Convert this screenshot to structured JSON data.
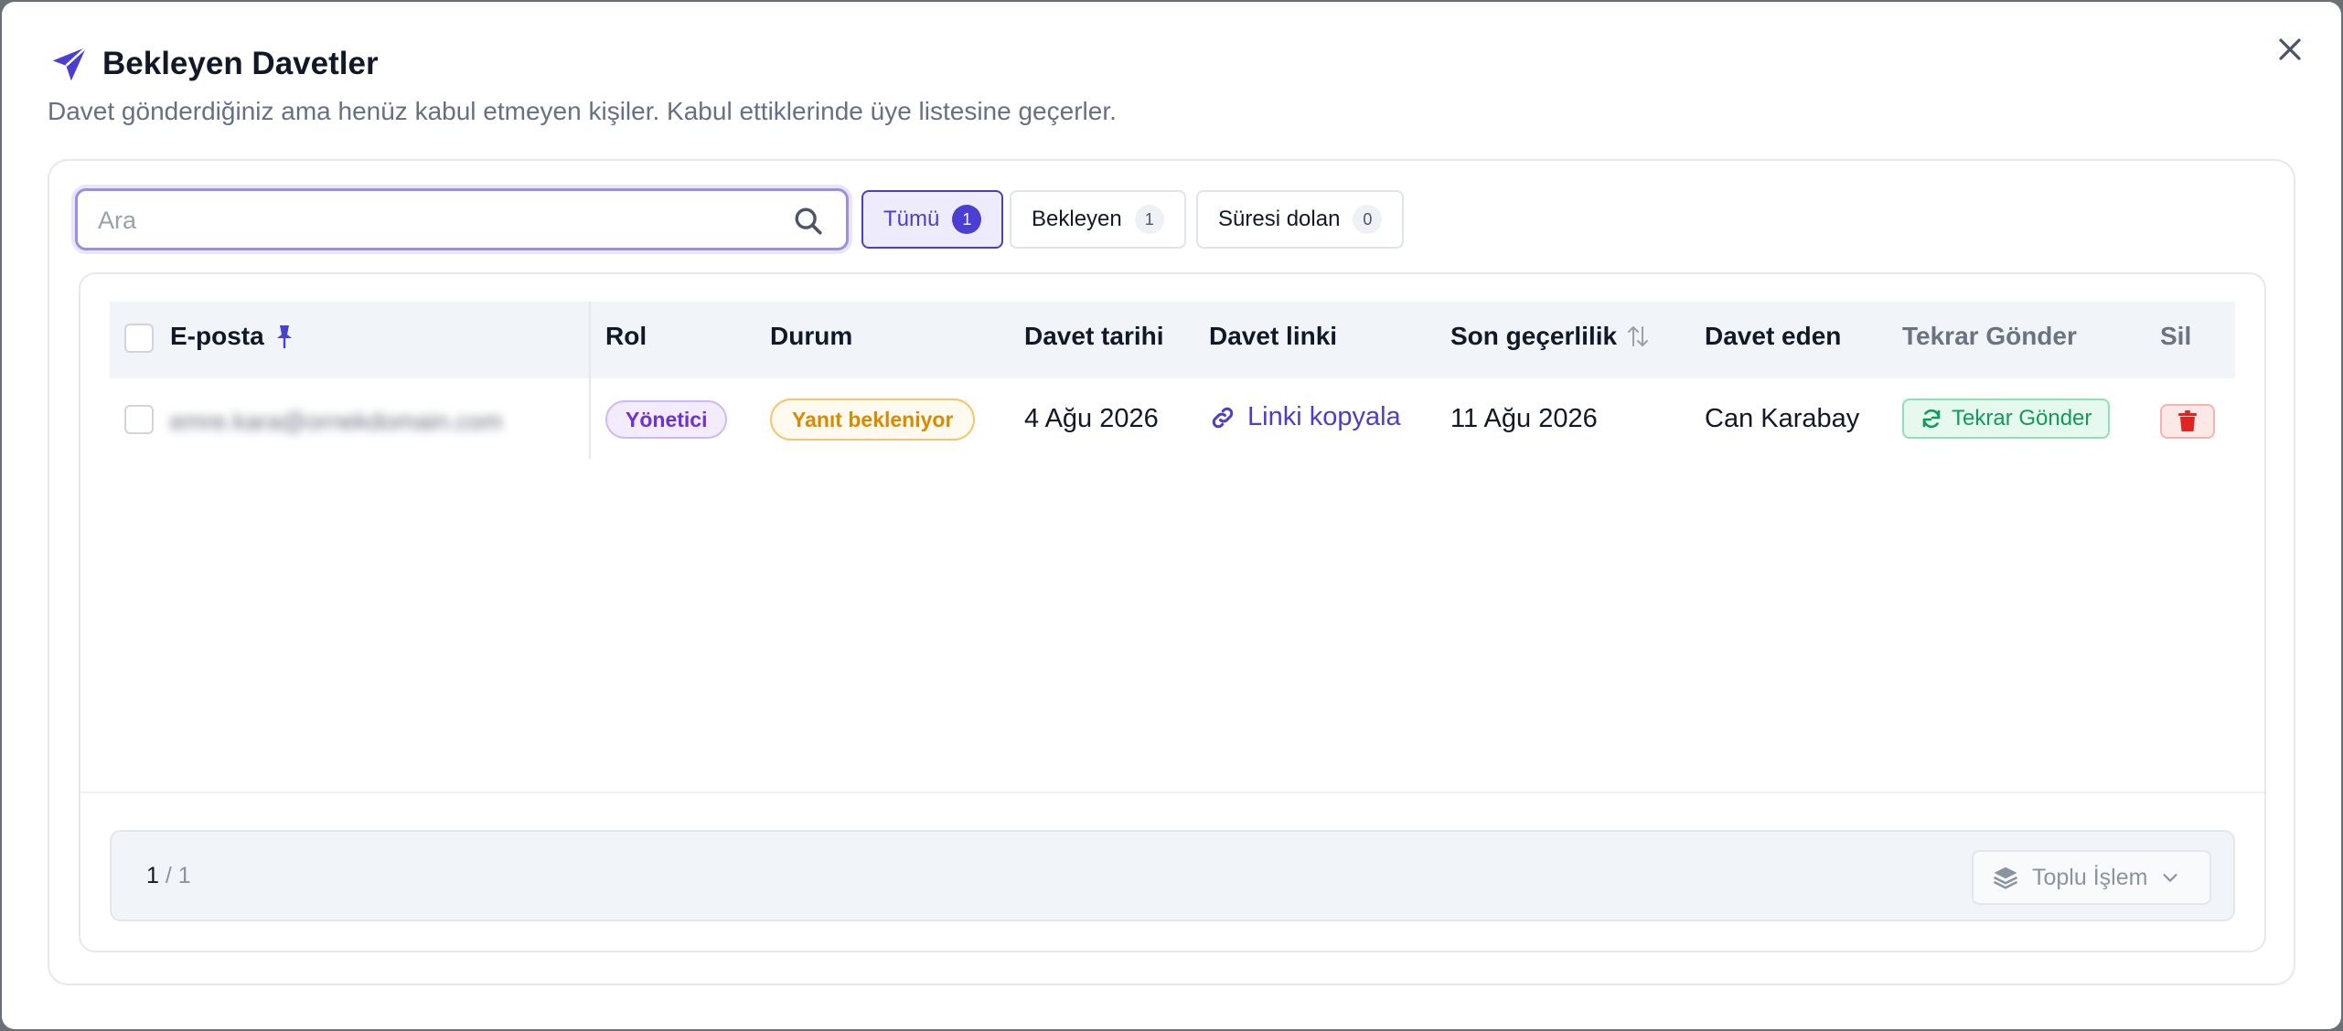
{
  "modal": {
    "title": "Bekleyen Davetler",
    "subtitle": "Davet gönderdiğiniz ama henüz kabul etmeyen kişiler. Kabul ettiklerinde üye listesine geçerler."
  },
  "search": {
    "placeholder": "Ara"
  },
  "filters": [
    {
      "label": "Tümü",
      "count": "1",
      "active": true
    },
    {
      "label": "Bekleyen",
      "count": "1",
      "active": false
    },
    {
      "label": "Süresi dolan",
      "count": "0",
      "active": false
    }
  ],
  "table": {
    "columns": {
      "email": "E-posta",
      "role": "Rol",
      "status": "Durum",
      "invite_date": "Davet tarihi",
      "invite_link": "Davet linki",
      "expiry": "Son geçerlilik",
      "invited_by": "Davet eden",
      "resend": "Tekrar Gönder",
      "delete": "Sil"
    },
    "rows": [
      {
        "email": "emre.kara@ornekdomain.com",
        "role": "Yönetici",
        "status": "Yanıt bekleniyor",
        "invite_date": "4 Ağu 2026",
        "invite_link": "Linki kopyala",
        "expiry": "11 Ağu 2026",
        "invited_by": "Can Karabay",
        "resend": "Tekrar Gönder"
      }
    ]
  },
  "footer": {
    "page_current": "1",
    "page_sep": "/",
    "page_total": "1",
    "bulk_label": "Toplu İşlem"
  },
  "colors": {
    "accent": "#4c3fc4",
    "role_badge": "#6b33d6",
    "status_pending": "#d98a00",
    "resend": "#129a5a",
    "delete": "#e02424"
  }
}
